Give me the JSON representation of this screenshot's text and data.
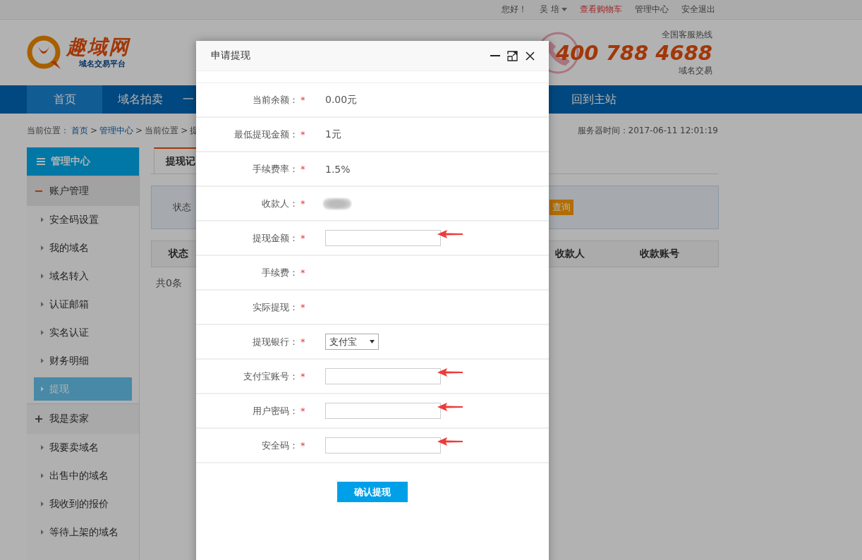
{
  "top_bar": {
    "greeting": "您好！",
    "user": "吴 培",
    "links": [
      {
        "label": "查看购物车",
        "highlight": true
      },
      {
        "label": "管理中心",
        "highlight": false
      },
      {
        "label": "安全退出",
        "highlight": false
      }
    ]
  },
  "header": {
    "logo": {
      "name": "趣域网",
      "tagline": "域名交易平台"
    },
    "hotline": {
      "label": "全国客服热线",
      "number": "400 788 4688",
      "caption": "域名交易"
    }
  },
  "nav": [
    {
      "label": "首页",
      "selected": true
    },
    {
      "label": "域名拍卖",
      "selected": false
    },
    {
      "label": "一",
      "selected": false
    },
    {
      "label": "回到主站",
      "selected": false
    }
  ],
  "breadcrumb": {
    "prefix": "当前位置：",
    "separator": ">",
    "items": [
      {
        "label": "首页",
        "link": true
      },
      {
        "label": "管理中心",
        "link": true
      },
      {
        "label": "当前位置",
        "link": false
      },
      {
        "label": "提",
        "link": false
      }
    ]
  },
  "server_time": "服务器时间：2017-06-11 12:01:19",
  "sidebar": {
    "title": "管理中心",
    "groups": [
      {
        "label": "账户管理",
        "active": true,
        "items": [
          {
            "label": "安全码设置",
            "selected": false
          },
          {
            "label": "我的域名",
            "selected": false
          },
          {
            "label": "域名转入",
            "selected": false
          },
          {
            "label": "认证邮箱",
            "selected": false
          },
          {
            "label": "实名认证",
            "selected": false
          },
          {
            "label": "财务明细",
            "selected": false
          },
          {
            "label": "提现",
            "selected": true
          }
        ]
      },
      {
        "label": "我是卖家",
        "active": false,
        "items": [
          {
            "label": "我要卖域名",
            "selected": false
          },
          {
            "label": "出售中的域名",
            "selected": false
          },
          {
            "label": "我收到的报价",
            "selected": false
          },
          {
            "label": "等待上架的域名",
            "selected": false
          }
        ]
      }
    ]
  },
  "content": {
    "tabs": [
      {
        "label": "提现记",
        "selected": true
      }
    ],
    "filter": {
      "label": "状态",
      "button": "查询"
    },
    "table": {
      "columns": [
        "状态",
        "收款人",
        "收款账号"
      ]
    },
    "summary": "共0条"
  },
  "dialog": {
    "title": "申请提现",
    "required_mark": "*",
    "fields": [
      {
        "label": "当前余额：",
        "kind": "text",
        "value": "0.00元"
      },
      {
        "label": "最低提现金额：",
        "kind": "text",
        "value": "1元"
      },
      {
        "label": "手续费率：",
        "kind": "text",
        "value": "1.5%"
      },
      {
        "label": "收款人：",
        "kind": "redacted"
      },
      {
        "label": "提现金额：",
        "kind": "input",
        "annotated": true
      },
      {
        "label": "手续费：",
        "kind": "empty"
      },
      {
        "label": "实际提现：",
        "kind": "empty"
      },
      {
        "label": "提现银行：",
        "kind": "select",
        "value": "支付宝"
      },
      {
        "label": "支付宝账号：",
        "kind": "input",
        "annotated": true
      },
      {
        "label": "用户密码：",
        "kind": "input",
        "annotated": true
      },
      {
        "label": "安全码：",
        "kind": "input",
        "annotated": true
      }
    ],
    "submit": "确认提现"
  }
}
